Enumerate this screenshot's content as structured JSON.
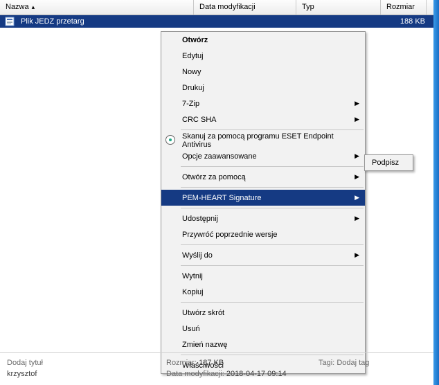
{
  "columns": {
    "name": "Nazwa",
    "date": "Data modyfikacji",
    "type": "Typ",
    "size": "Rozmiar"
  },
  "file": {
    "name": "Plik JEDZ przetarg",
    "size": "188 KB"
  },
  "menu": {
    "open": "Otwórz",
    "edit": "Edytuj",
    "new": "Nowy",
    "print": "Drukuj",
    "sevenzip": "7-Zip",
    "crcsha": "CRC SHA",
    "scan": "Skanuj za pomocą programu ESET Endpoint Antivirus",
    "advopts": "Opcje zaawansowane",
    "openwith": "Otwórz za pomocą",
    "pemheart": "PEM-HEART Signature",
    "share": "Udostępnij",
    "restore": "Przywróć poprzednie wersje",
    "sendto": "Wyślij do",
    "cut": "Wytnij",
    "copy": "Kopiuj",
    "shortcut": "Utwórz skrót",
    "delete": "Usuń",
    "rename": "Zmień nazwę",
    "props": "Właściwości"
  },
  "submenu": {
    "sign": "Podpisz"
  },
  "details": {
    "title_label": "Dodaj tytuł",
    "author": "krzysztof",
    "size_label": "Rozmiar:",
    "size_value": "187 KB",
    "date_label": "Data modyfikacji:",
    "date_value": "2018-04-17 09:14",
    "tags_label": "Tagi:",
    "tags_value": "Dodaj tag"
  }
}
